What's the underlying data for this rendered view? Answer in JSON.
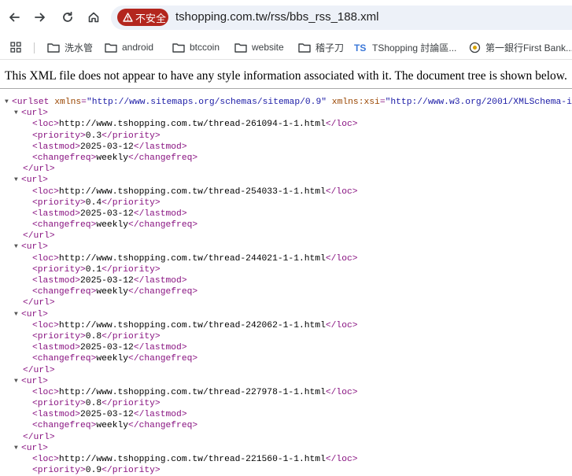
{
  "browser": {
    "security_label": "不安全",
    "url": "tshopping.com.tw/rss/bbs_rss_188.xml"
  },
  "bookmarks": [
    {
      "label": "洗水管",
      "icon": "folder-icon"
    },
    {
      "label": "android",
      "icon": "folder-icon"
    },
    {
      "label": "btccoin",
      "icon": "folder-icon"
    },
    {
      "label": "website",
      "icon": "folder-icon"
    },
    {
      "label": "稽子刀",
      "icon": "folder-icon"
    },
    {
      "label": "TShopping 討論區...",
      "icon": "ts-logo-icon"
    },
    {
      "label": "第一銀行First Bank...",
      "icon": "first-bank-icon"
    }
  ],
  "notice": "This XML file does not appear to have any style information associated with it. The document tree is shown below.",
  "xml": {
    "root_tag": "urlset",
    "xmlns_name": "xmlns",
    "xmlns_value": "http://www.sitemaps.org/schemas/sitemap/0.9",
    "xsi_name": "xmlns:xsi",
    "xsi_value": "http://www.w3.org/2001/XMLSchema-i",
    "entries": [
      {
        "loc": "http://www.tshopping.com.tw/thread-261094-1-1.html",
        "priority": "0.3",
        "lastmod": "2025-03-12",
        "changefreq": "weekly"
      },
      {
        "loc": "http://www.tshopping.com.tw/thread-254033-1-1.html",
        "priority": "0.4",
        "lastmod": "2025-03-12",
        "changefreq": "weekly"
      },
      {
        "loc": "http://www.tshopping.com.tw/thread-244021-1-1.html",
        "priority": "0.1",
        "lastmod": "2025-03-12",
        "changefreq": "weekly"
      },
      {
        "loc": "http://www.tshopping.com.tw/thread-242062-1-1.html",
        "priority": "0.8",
        "lastmod": "2025-03-12",
        "changefreq": "weekly"
      },
      {
        "loc": "http://www.tshopping.com.tw/thread-227978-1-1.html",
        "priority": "0.8",
        "lastmod": "2025-03-12",
        "changefreq": "weekly"
      },
      {
        "loc": "http://www.tshopping.com.tw/thread-221560-1-1.html",
        "priority": "0.9"
      }
    ]
  }
}
